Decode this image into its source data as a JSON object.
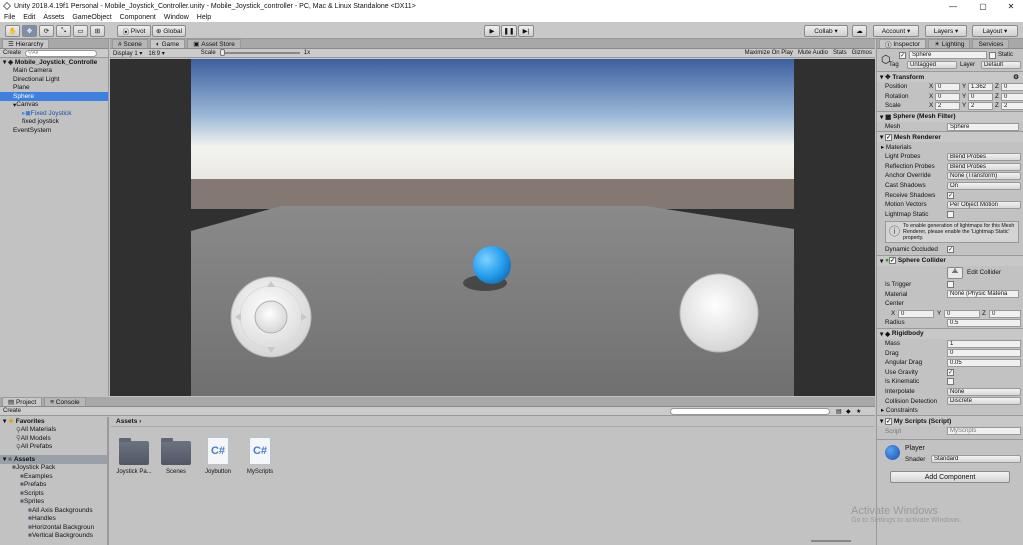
{
  "window": {
    "title": "Unity 2018.4.19f1 Personal - Mobile_Joystick_Controller.unity - Mobile_Joystick_controller - PC, Mac & Linux Standalone <DX11>"
  },
  "menu": [
    "File",
    "Edit",
    "Assets",
    "GameObject",
    "Component",
    "Window",
    "Help"
  ],
  "toolbar": {
    "pivot": "Pivot",
    "global": "Global",
    "collab": "Collab",
    "account": "Account",
    "layers": "Layers",
    "layout": "Layout"
  },
  "hierarchy": {
    "tab": "Hierarchy",
    "create": "Create",
    "search_placeholder": "All",
    "scene": "Mobile_Joystick_Controlle",
    "items": [
      {
        "label": "Main Camera",
        "indent": 1
      },
      {
        "label": "Directional Light",
        "indent": 1
      },
      {
        "label": "Plane",
        "indent": 1
      },
      {
        "label": "Sphere",
        "indent": 1,
        "selected": true
      },
      {
        "label": "Canvas",
        "indent": 1
      },
      {
        "label": "Fixed Joystick",
        "indent": 2,
        "prefab": true
      },
      {
        "label": "fixed joystick",
        "indent": 2
      },
      {
        "label": "EventSystem",
        "indent": 1
      }
    ]
  },
  "game": {
    "tabs": [
      "Scene",
      "Game",
      "Asset Store"
    ],
    "display": "Display 1",
    "aspect": "16:9",
    "scale_label": "Scale",
    "scale_value": "1x",
    "buttons": [
      "Maximize On Play",
      "Mute Audio",
      "Stats",
      "Gizmos"
    ]
  },
  "inspector": {
    "tabs": [
      "Inspector",
      "Lighting",
      "Services"
    ],
    "object_name": "Sphere",
    "static": "Static",
    "tag_label": "Tag",
    "tag": "Untagged",
    "layer_label": "Layer",
    "layer": "Default",
    "transform": {
      "title": "Transform",
      "rows": [
        {
          "label": "Position",
          "x": "0",
          "y": "1.362",
          "z": "0"
        },
        {
          "label": "Rotation",
          "x": "0",
          "y": "0",
          "z": "0"
        },
        {
          "label": "Scale",
          "x": "2",
          "y": "2",
          "z": "2"
        }
      ]
    },
    "mesh_filter": {
      "title": "Sphere (Mesh Filter)",
      "mesh_label": "Mesh",
      "mesh": "Sphere"
    },
    "mesh_renderer": {
      "title": "Mesh Renderer",
      "materials": "Materials",
      "rows": [
        {
          "label": "Light Probes",
          "value": "Blend Probes"
        },
        {
          "label": "Reflection Probes",
          "value": "Blend Probes"
        },
        {
          "label": "Anchor Override",
          "value": "None (Transform)"
        },
        {
          "label": "Cast Shadows",
          "value": "On"
        },
        {
          "label": "Receive Shadows",
          "value": ""
        },
        {
          "label": "Motion Vectors",
          "value": "Per Object Motion"
        }
      ],
      "lightmap_static": "Lightmap Static",
      "info": "To enable generation of lightmaps for this Mesh Renderer, please enable the 'Lightmap Static' property.",
      "dynamic_occluded": "Dynamic Occluded"
    },
    "sphere_collider": {
      "title": "Sphere Collider",
      "edit": "Edit Collider",
      "is_trigger": "Is Trigger",
      "material_label": "Material",
      "material": "None (Physic Materia",
      "center_label": "Center",
      "cx": "0",
      "cy": "0",
      "cz": "0",
      "radius_label": "Radius",
      "radius": "0.5"
    },
    "rigidbody": {
      "title": "Rigidbody",
      "mass_label": "Mass",
      "mass": "1",
      "drag_label": "Drag",
      "drag": "0",
      "angular_label": "Angular Drag",
      "angular": "0.05",
      "gravity": "Use Gravity",
      "kinematic": "Is Kinematic",
      "interp_label": "Interpolate",
      "interp": "None",
      "collision_label": "Collision Detection",
      "collision": "Discrete",
      "constraints": "Constraints"
    },
    "my_scripts": {
      "title": "My Scripts (Script)",
      "script_label": "Script",
      "script": "MyScripts"
    },
    "material": {
      "name": "Player",
      "shader_label": "Shader",
      "shader": "Standard"
    },
    "add_component": "Add Component"
  },
  "project": {
    "tabs": [
      "Project",
      "Console"
    ],
    "create": "Create",
    "favorites": {
      "title": "Favorites",
      "items": [
        "All Materials",
        "All Models",
        "All Prefabs"
      ]
    },
    "assets_tree": {
      "title": "Assets",
      "items": [
        {
          "label": "Joystick Pack",
          "indent": 1
        },
        {
          "label": "Examples",
          "indent": 2
        },
        {
          "label": "Prefabs",
          "indent": 2
        },
        {
          "label": "Scripts",
          "indent": 2
        },
        {
          "label": "Sprites",
          "indent": 2
        },
        {
          "label": "All Axis Backgrounds",
          "indent": 3
        },
        {
          "label": "Handles",
          "indent": 3
        },
        {
          "label": "Horizontal Backgroun",
          "indent": 3
        },
        {
          "label": "Vertical Backgrounds",
          "indent": 3
        }
      ]
    },
    "breadcrumb": "Assets",
    "assets": [
      {
        "label": "Joystick Pa...",
        "kind": "folder"
      },
      {
        "label": "Scenes",
        "kind": "folder"
      },
      {
        "label": "Joybutton",
        "kind": "cs"
      },
      {
        "label": "MyScripts",
        "kind": "cs"
      }
    ],
    "cs_glyph": "C#"
  },
  "watermark": {
    "line1": "Activate Windows",
    "line2": "Go to Settings to activate Windows."
  },
  "colors": {
    "selection": "#3d80df",
    "sky_top": "#3f66a8",
    "ground": "#8a8a8a",
    "ball": "#3ba3f0"
  }
}
